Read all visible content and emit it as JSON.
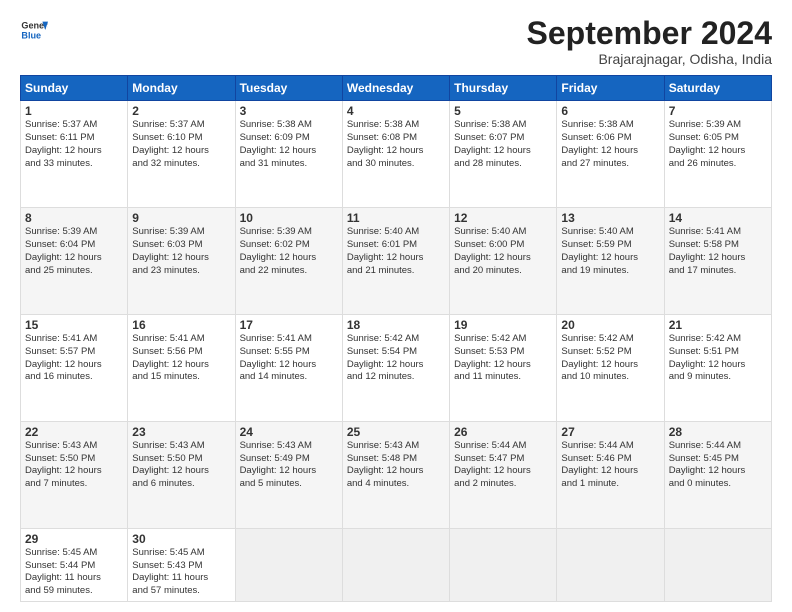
{
  "header": {
    "logo_line1": "General",
    "logo_line2": "Blue",
    "month": "September 2024",
    "location": "Brajarajnagar, Odisha, India"
  },
  "weekdays": [
    "Sunday",
    "Monday",
    "Tuesday",
    "Wednesday",
    "Thursday",
    "Friday",
    "Saturday"
  ],
  "weeks": [
    [
      {
        "day": "1",
        "info": "Sunrise: 5:37 AM\nSunset: 6:11 PM\nDaylight: 12 hours\nand 33 minutes."
      },
      {
        "day": "2",
        "info": "Sunrise: 5:37 AM\nSunset: 6:10 PM\nDaylight: 12 hours\nand 32 minutes."
      },
      {
        "day": "3",
        "info": "Sunrise: 5:38 AM\nSunset: 6:09 PM\nDaylight: 12 hours\nand 31 minutes."
      },
      {
        "day": "4",
        "info": "Sunrise: 5:38 AM\nSunset: 6:08 PM\nDaylight: 12 hours\nand 30 minutes."
      },
      {
        "day": "5",
        "info": "Sunrise: 5:38 AM\nSunset: 6:07 PM\nDaylight: 12 hours\nand 28 minutes."
      },
      {
        "day": "6",
        "info": "Sunrise: 5:38 AM\nSunset: 6:06 PM\nDaylight: 12 hours\nand 27 minutes."
      },
      {
        "day": "7",
        "info": "Sunrise: 5:39 AM\nSunset: 6:05 PM\nDaylight: 12 hours\nand 26 minutes."
      }
    ],
    [
      {
        "day": "8",
        "info": "Sunrise: 5:39 AM\nSunset: 6:04 PM\nDaylight: 12 hours\nand 25 minutes."
      },
      {
        "day": "9",
        "info": "Sunrise: 5:39 AM\nSunset: 6:03 PM\nDaylight: 12 hours\nand 23 minutes."
      },
      {
        "day": "10",
        "info": "Sunrise: 5:39 AM\nSunset: 6:02 PM\nDaylight: 12 hours\nand 22 minutes."
      },
      {
        "day": "11",
        "info": "Sunrise: 5:40 AM\nSunset: 6:01 PM\nDaylight: 12 hours\nand 21 minutes."
      },
      {
        "day": "12",
        "info": "Sunrise: 5:40 AM\nSunset: 6:00 PM\nDaylight: 12 hours\nand 20 minutes."
      },
      {
        "day": "13",
        "info": "Sunrise: 5:40 AM\nSunset: 5:59 PM\nDaylight: 12 hours\nand 19 minutes."
      },
      {
        "day": "14",
        "info": "Sunrise: 5:41 AM\nSunset: 5:58 PM\nDaylight: 12 hours\nand 17 minutes."
      }
    ],
    [
      {
        "day": "15",
        "info": "Sunrise: 5:41 AM\nSunset: 5:57 PM\nDaylight: 12 hours\nand 16 minutes."
      },
      {
        "day": "16",
        "info": "Sunrise: 5:41 AM\nSunset: 5:56 PM\nDaylight: 12 hours\nand 15 minutes."
      },
      {
        "day": "17",
        "info": "Sunrise: 5:41 AM\nSunset: 5:55 PM\nDaylight: 12 hours\nand 14 minutes."
      },
      {
        "day": "18",
        "info": "Sunrise: 5:42 AM\nSunset: 5:54 PM\nDaylight: 12 hours\nand 12 minutes."
      },
      {
        "day": "19",
        "info": "Sunrise: 5:42 AM\nSunset: 5:53 PM\nDaylight: 12 hours\nand 11 minutes."
      },
      {
        "day": "20",
        "info": "Sunrise: 5:42 AM\nSunset: 5:52 PM\nDaylight: 12 hours\nand 10 minutes."
      },
      {
        "day": "21",
        "info": "Sunrise: 5:42 AM\nSunset: 5:51 PM\nDaylight: 12 hours\nand 9 minutes."
      }
    ],
    [
      {
        "day": "22",
        "info": "Sunrise: 5:43 AM\nSunset: 5:50 PM\nDaylight: 12 hours\nand 7 minutes."
      },
      {
        "day": "23",
        "info": "Sunrise: 5:43 AM\nSunset: 5:50 PM\nDaylight: 12 hours\nand 6 minutes."
      },
      {
        "day": "24",
        "info": "Sunrise: 5:43 AM\nSunset: 5:49 PM\nDaylight: 12 hours\nand 5 minutes."
      },
      {
        "day": "25",
        "info": "Sunrise: 5:43 AM\nSunset: 5:48 PM\nDaylight: 12 hours\nand 4 minutes."
      },
      {
        "day": "26",
        "info": "Sunrise: 5:44 AM\nSunset: 5:47 PM\nDaylight: 12 hours\nand 2 minutes."
      },
      {
        "day": "27",
        "info": "Sunrise: 5:44 AM\nSunset: 5:46 PM\nDaylight: 12 hours\nand 1 minute."
      },
      {
        "day": "28",
        "info": "Sunrise: 5:44 AM\nSunset: 5:45 PM\nDaylight: 12 hours\nand 0 minutes."
      }
    ],
    [
      {
        "day": "29",
        "info": "Sunrise: 5:45 AM\nSunset: 5:44 PM\nDaylight: 11 hours\nand 59 minutes."
      },
      {
        "day": "30",
        "info": "Sunrise: 5:45 AM\nSunset: 5:43 PM\nDaylight: 11 hours\nand 57 minutes."
      },
      {
        "day": "",
        "info": ""
      },
      {
        "day": "",
        "info": ""
      },
      {
        "day": "",
        "info": ""
      },
      {
        "day": "",
        "info": ""
      },
      {
        "day": "",
        "info": ""
      }
    ]
  ]
}
